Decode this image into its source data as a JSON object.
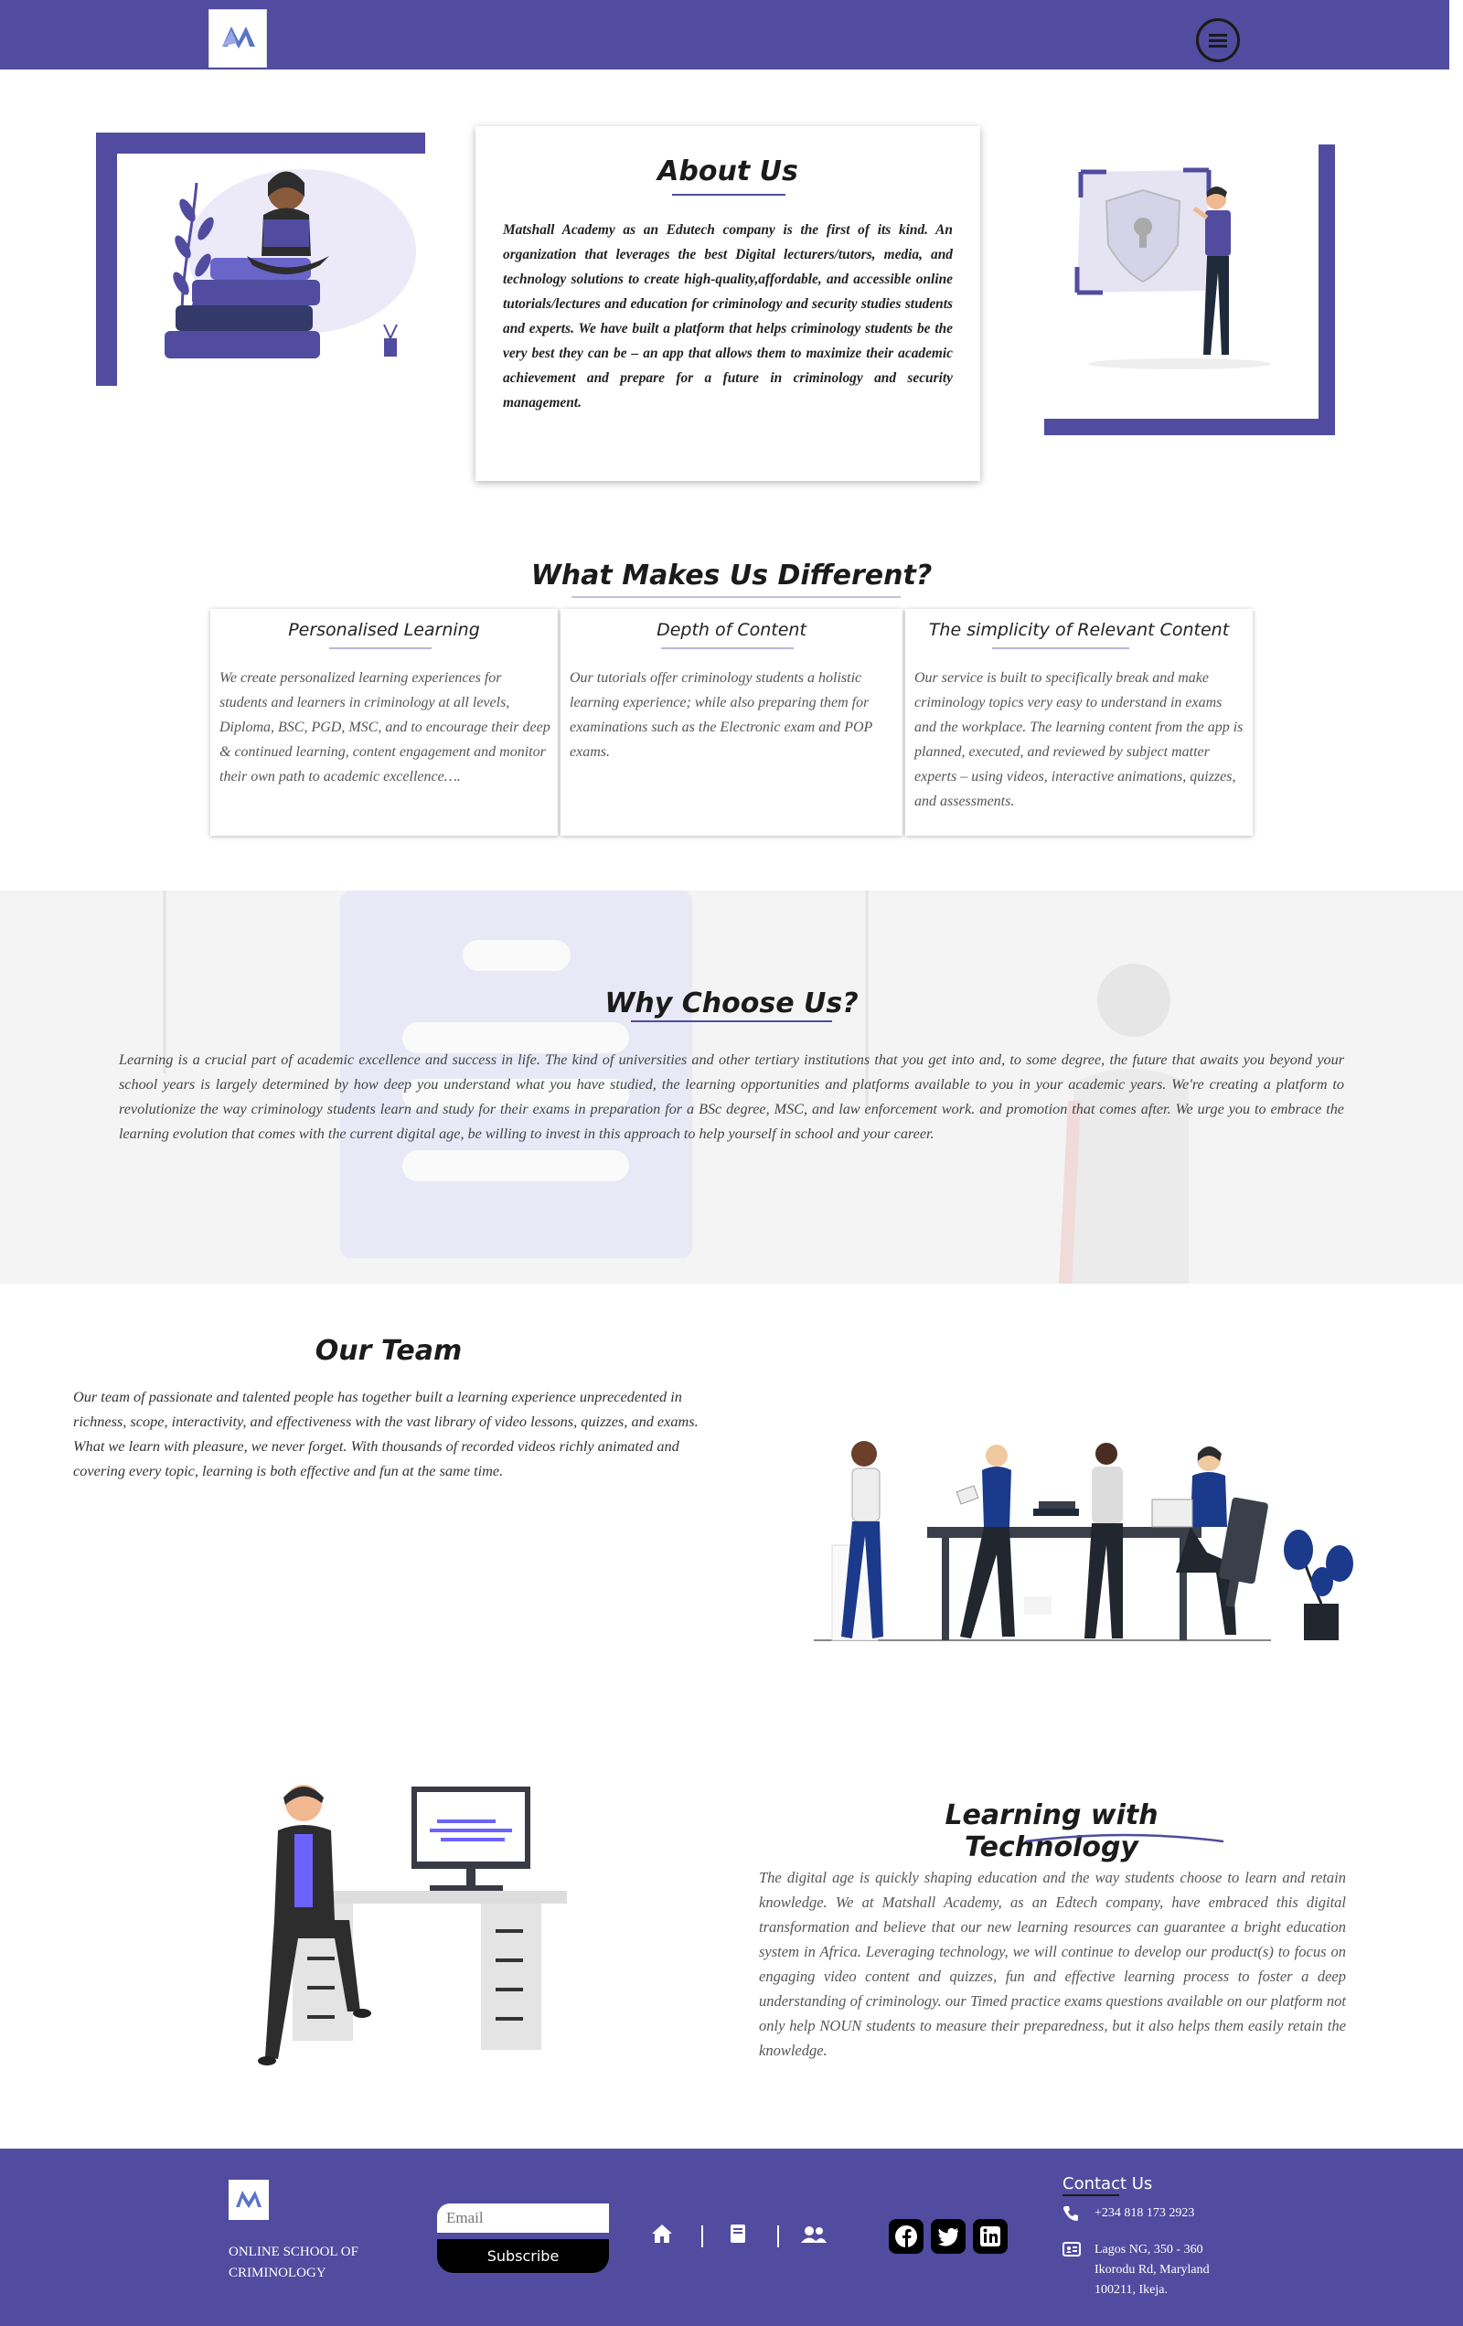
{
  "header": {
    "logo_text": "Matshall Academy",
    "menu_icon": "hamburger-menu-icon"
  },
  "about": {
    "title": "About Us",
    "body": "Matshall Academy as an Edutech company is the first of its kind. An organization that leverages the best Digital lecturers/tutors, media, and technology solutions to create high-quality,affordable, and accessible online tutorials/lectures and education for criminology and security studies students and experts. We have built a platform that helps criminology students be the very best they can be – an app that allows them to maximize their academic achievement and prepare for a future in criminology and security management."
  },
  "different": {
    "title": "What Makes Us Different?",
    "features": [
      {
        "title": "Personalised Learning",
        "body": "We create personalized learning experiences for students and learners in criminology at all levels, Diploma, BSC, PGD, MSC, and to encourage their deep & continued learning, content engagement and monitor their own path to academic excellence…."
      },
      {
        "title": "Depth of Content",
        "body": "Our tutorials offer criminology students a holistic learning experience; while also preparing them for examinations such as the Electronic exam and POP exams."
      },
      {
        "title": "The simplicity of Relevant Content",
        "body": "Our service is built to specifically break and make criminology topics very easy to understand in exams and the workplace. The learning content from the app is planned, executed, and reviewed by subject matter experts – using videos, interactive animations, quizzes, and assessments."
      }
    ]
  },
  "why": {
    "title": "Why Choose Us?",
    "body": "Learning is a crucial part of academic excellence and success in life. The kind of universities and other tertiary institutions that you get into and, to some degree, the future that awaits you beyond your school years is largely determined by how deep you understand what you have studied, the learning opportunities and platforms available to you in your academic years. We're creating a platform to revolutionize the way criminology students learn and study for their exams in preparation for a BSc degree, MSC, and law enforcement work. and promotion that comes after. We urge you to embrace the learning evolution that comes with the current digital age, be willing to invest in this approach to help yourself in school and your career."
  },
  "team": {
    "title": "Our Team",
    "body": " Our team of passionate and talented people has together built a learning experience unprecedented in richness, scope, interactivity, and effectiveness with the vast library of video lessons, quizzes, and exams. What we learn with pleasure, we never forget. With thousands of recorded videos richly animated and covering every topic, learning is both effective and fun at the same time."
  },
  "tech": {
    "title": "Learning with Technology",
    "body": "The digital age is quickly shaping education and the way students choose to learn and retain knowledge. We at Matshall Academy, as an Edtech company, have embraced this digital transformation and believe that our new learning resources can guarantee a bright education system in Africa. Leveraging technology, we will continue to develop our product(s) to focus on engaging video content and quizzes, fun and effective learning process to foster a deep understanding of criminology. our Timed practice exams questions available on our platform not only help NOUN students to measure their preparedness, but it also helps them easily retain the knowledge."
  },
  "footer": {
    "school_name": "ONLINE SCHOOL OF CRIMINOLOGY",
    "email_placeholder": "Email",
    "subscribe_label": "Subscribe",
    "contact_title": "Contact Us",
    "phone": "+234 818 173 2923",
    "address": "Lagos NG, 350 - 360 Ikorodu Rd, Maryland 100211, Ikeja.",
    "colors": {
      "brand": "#514c9f",
      "accent": "#1b3a8c"
    }
  }
}
